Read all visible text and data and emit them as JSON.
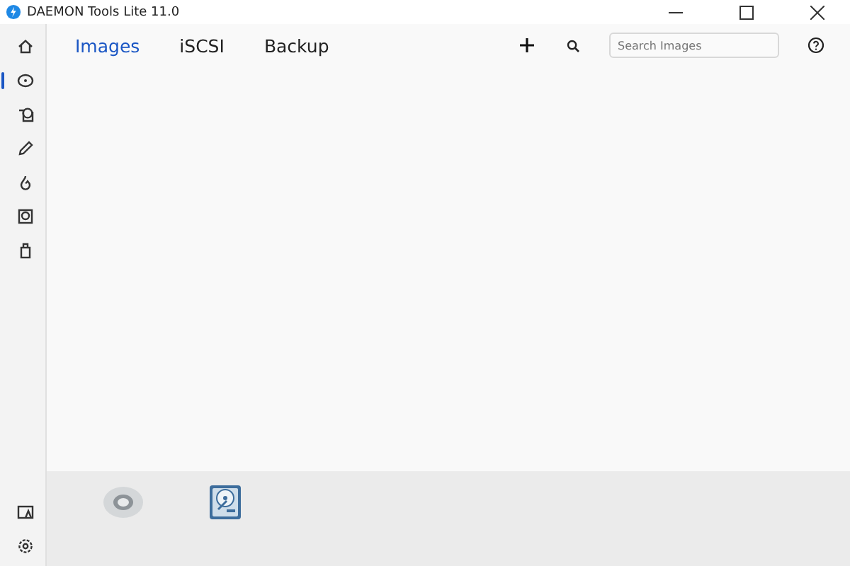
{
  "window": {
    "title": "DAEMON Tools Lite 11.0"
  },
  "sidebar": {
    "items": [
      {
        "kind": "home",
        "selected": false
      },
      {
        "kind": "disc",
        "selected": true
      },
      {
        "kind": "image",
        "selected": false
      },
      {
        "kind": "pencil",
        "selected": false
      },
      {
        "kind": "flame",
        "selected": false
      },
      {
        "kind": "drive",
        "selected": false
      },
      {
        "kind": "usb",
        "selected": false
      }
    ],
    "bottom_items": [
      {
        "kind": "license",
        "selected": false
      },
      {
        "kind": "settings",
        "selected": false
      }
    ]
  },
  "tabs": [
    {
      "label": "Images",
      "selected": true
    },
    {
      "label": "iSCSI",
      "selected": false
    },
    {
      "label": "Backup",
      "selected": false
    }
  ],
  "search": {
    "placeholder": "Search Images"
  },
  "drives": [
    {
      "kind": "optical"
    },
    {
      "kind": "hdd"
    }
  ]
}
